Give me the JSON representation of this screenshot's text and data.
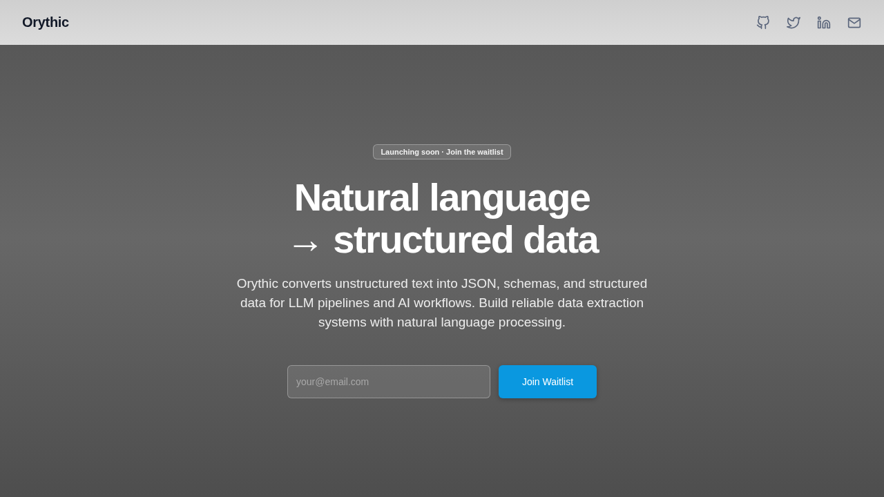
{
  "header": {
    "logo": "Orythic",
    "social_links": [
      {
        "kind": "github"
      },
      {
        "kind": "twitter"
      },
      {
        "kind": "linkedin"
      },
      {
        "kind": "mail"
      }
    ]
  },
  "hero": {
    "badge": "Launching soon · Join the waitlist",
    "headline": [
      "**Natural language**",
      "→ **structured data**"
    ],
    "description": "Orythic converts unstructured text into JSON, schemas, and structured data for LLM pipelines and AI workflows. Build reliable data extraction systems with natural language processing.",
    "form": {
      "email": {
        "placeholder": "your@email.com"
      },
      "button": "Join Waitlist"
    }
  }
}
